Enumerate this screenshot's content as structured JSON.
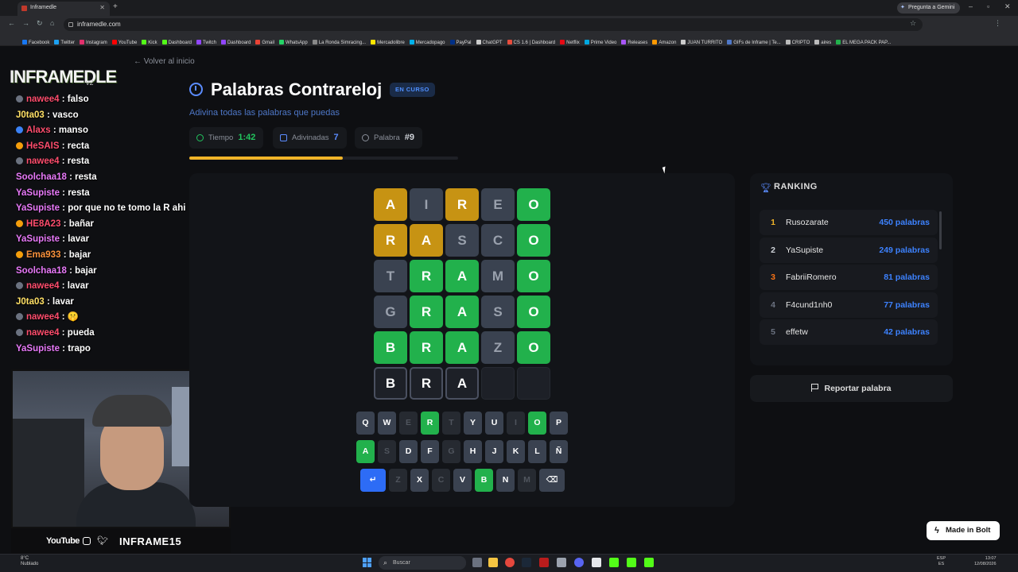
{
  "browser": {
    "tab_title": "Inframedle",
    "new_tab": "+",
    "url": "inframedle.com",
    "gemini": "Pregunta a Gemini",
    "bookmarks": [
      {
        "label": "Facebook",
        "color": "#1877f2"
      },
      {
        "label": "Twitter",
        "color": "#1da1f2"
      },
      {
        "label": "Instagram",
        "color": "#e1306c"
      },
      {
        "label": "YouTube",
        "color": "#ff0000"
      },
      {
        "label": "Kick",
        "color": "#53fc18"
      },
      {
        "label": "Dashboard",
        "color": "#53fc18"
      },
      {
        "label": "Twitch",
        "color": "#9146ff"
      },
      {
        "label": "Dashboard",
        "color": "#9146ff"
      },
      {
        "label": "Gmail",
        "color": "#ea4335"
      },
      {
        "label": "WhatsApp",
        "color": "#25d366"
      },
      {
        "label": "La Ronda Simracing...",
        "color": "#888888"
      },
      {
        "label": "Mercadolibre",
        "color": "#ffe600"
      },
      {
        "label": "Mercadopago",
        "color": "#00b1ea"
      },
      {
        "label": "PayPal",
        "color": "#003087"
      },
      {
        "label": "ChatGPT",
        "color": "#cccccc"
      },
      {
        "label": "CS 1.6 | Dashboard",
        "color": "#e74c3c"
      },
      {
        "label": "Netflix",
        "color": "#e50914"
      },
      {
        "label": "Prime Video",
        "color": "#00a8e1"
      },
      {
        "label": "Releases",
        "color": "#a855f7"
      },
      {
        "label": "Amazon",
        "color": "#ff9900"
      },
      {
        "label": "JUAN TURRITO",
        "color": "#cccccc"
      },
      {
        "label": "GIFs de Inframe | Te...",
        "color": "#4e77c7"
      },
      {
        "label": "CRIPTO",
        "color": "#bbbbbb"
      },
      {
        "label": "aires",
        "color": "#bbbbbb"
      },
      {
        "label": "EL MEGA PACK PAP...",
        "color": "#22b14c"
      }
    ]
  },
  "stream": {
    "logo": "INFRAMEDLE",
    "logo_version": "v2",
    "chat": [
      {
        "user": "nawee4",
        "text": ": falso",
        "color": "#ff4d6d",
        "icon": "#6b7280"
      },
      {
        "user": "J0ta03",
        "text": ": vasco",
        "color": "#ffe066",
        "icon": ""
      },
      {
        "user": "Alaxs",
        "text": ": manso",
        "color": "#ff4d6d",
        "icon": "#3b82f6"
      },
      {
        "user": "HeSAIS",
        "text": ": recta",
        "color": "#ff4d6d",
        "icon": "#f59e0b"
      },
      {
        "user": "nawee4",
        "text": ": resta",
        "color": "#ff4d6d",
        "icon": "#6b7280"
      },
      {
        "user": "Soolchaa18",
        "text": ": resta",
        "color": "#e879f9",
        "icon": ""
      },
      {
        "user": "YaSupiste",
        "text": ": resta",
        "color": "#e879f9",
        "icon": ""
      },
      {
        "user": "YaSupiste",
        "text": ": por que no te tomo la R ahi",
        "color": "#e879f9",
        "icon": ""
      },
      {
        "user": "HE8A23",
        "text": ": bañar",
        "color": "#ff4d6d",
        "icon": "#f59e0b"
      },
      {
        "user": "YaSupiste",
        "text": ": lavar",
        "color": "#e879f9",
        "icon": ""
      },
      {
        "user": "Ema933",
        "text": ": bajar",
        "color": "#fb923c",
        "icon": "#f59e0b"
      },
      {
        "user": "Soolchaa18",
        "text": ": bajar",
        "color": "#e879f9",
        "icon": ""
      },
      {
        "user": "nawee4",
        "text": ": lavar",
        "color": "#ff4d6d",
        "icon": "#6b7280"
      },
      {
        "user": "J0ta03",
        "text": ": lavar",
        "color": "#ffe066",
        "icon": ""
      },
      {
        "user": "nawee4",
        "text": ": 🤫",
        "color": "#ff4d6d",
        "icon": "#6b7280"
      },
      {
        "user": "nawee4",
        "text": ": pueda",
        "color": "#ff4d6d",
        "icon": "#6b7280"
      },
      {
        "user": "YaSupiste",
        "text": ": trapo",
        "color": "#e879f9",
        "icon": ""
      }
    ],
    "social_youtube": "YouTube",
    "social_name": "INFRAME15"
  },
  "game": {
    "back": "← Volver al inicio",
    "title": "Palabras Contrareloj",
    "status": "EN CURSO",
    "subtitle": "Adivina todas las palabras que puedas",
    "stats": [
      {
        "label": "Tiempo",
        "value": "1:42",
        "color": "#22c55e"
      },
      {
        "label": "Adivinadas",
        "value": "7",
        "color": "#5b8cff"
      },
      {
        "label": "Palabra",
        "value": "#9",
        "color": "#d1d5db"
      }
    ],
    "time_progress": 0.57,
    "grid": [
      [
        [
          "A",
          "y"
        ],
        [
          "I",
          "x"
        ],
        [
          "R",
          "y"
        ],
        [
          "E",
          "x"
        ],
        [
          "O",
          "g"
        ]
      ],
      [
        [
          "R",
          "y"
        ],
        [
          "A",
          "y"
        ],
        [
          "S",
          "x"
        ],
        [
          "C",
          "x"
        ],
        [
          "O",
          "g"
        ]
      ],
      [
        [
          "T",
          "x"
        ],
        [
          "R",
          "g"
        ],
        [
          "A",
          "g"
        ],
        [
          "M",
          "x"
        ],
        [
          "O",
          "g"
        ]
      ],
      [
        [
          "G",
          "x"
        ],
        [
          "R",
          "g"
        ],
        [
          "A",
          "g"
        ],
        [
          "S",
          "x"
        ],
        [
          "O",
          "g"
        ]
      ],
      [
        [
          "B",
          "g"
        ],
        [
          "R",
          "g"
        ],
        [
          "A",
          "g"
        ],
        [
          "Z",
          "x"
        ],
        [
          "O",
          "g"
        ]
      ],
      [
        [
          "B",
          "t"
        ],
        [
          "R",
          "t"
        ],
        [
          "A",
          "t"
        ],
        [
          "",
          "e"
        ],
        [
          "",
          "e"
        ]
      ]
    ],
    "keyboard": [
      [
        [
          "Q",
          "n"
        ],
        [
          "W",
          "n"
        ],
        [
          "E",
          "d"
        ],
        [
          "R",
          "g"
        ],
        [
          "T",
          "d"
        ],
        [
          "Y",
          "n"
        ],
        [
          "U",
          "n"
        ],
        [
          "I",
          "d"
        ],
        [
          "O",
          "g"
        ],
        [
          "P",
          "n"
        ]
      ],
      [
        [
          "A",
          "g"
        ],
        [
          "S",
          "d"
        ],
        [
          "D",
          "n"
        ],
        [
          "F",
          "n"
        ],
        [
          "G",
          "d"
        ],
        [
          "H",
          "n"
        ],
        [
          "J",
          "n"
        ],
        [
          "K",
          "n"
        ],
        [
          "L",
          "n"
        ],
        [
          "Ñ",
          "n"
        ]
      ],
      [
        [
          "↵",
          "enter"
        ],
        [
          "Z",
          "d"
        ],
        [
          "X",
          "n"
        ],
        [
          "C",
          "d"
        ],
        [
          "V",
          "n"
        ],
        [
          "B",
          "g"
        ],
        [
          "N",
          "n"
        ],
        [
          "M",
          "d"
        ],
        [
          "⌫",
          "n"
        ]
      ]
    ]
  },
  "ranking": {
    "title": "RANKING",
    "rows": [
      {
        "rank": "1",
        "name": "Rusozarate",
        "value": "450 palabras",
        "color": "#f0b429"
      },
      {
        "rank": "2",
        "name": "YaSupiste",
        "value": "249 palabras",
        "color": "#d1d5db"
      },
      {
        "rank": "3",
        "name": "FabriiRomero",
        "value": "81 palabras",
        "color": "#f97316"
      },
      {
        "rank": "4",
        "name": "F4cund1nh0",
        "value": "77 palabras",
        "color": "#6b7280"
      },
      {
        "rank": "5",
        "name": "effetw",
        "value": "42 palabras",
        "color": "#6b7280"
      }
    ]
  },
  "report": "Reportar palabra",
  "bolt": "Made in Bolt",
  "taskbar": {
    "weather": "8°C",
    "weather_sub": "Nublado",
    "search": "Buscar",
    "lang": "ESP",
    "lang_sub": "ES",
    "time": "13:07",
    "date": "12/08/2026"
  }
}
